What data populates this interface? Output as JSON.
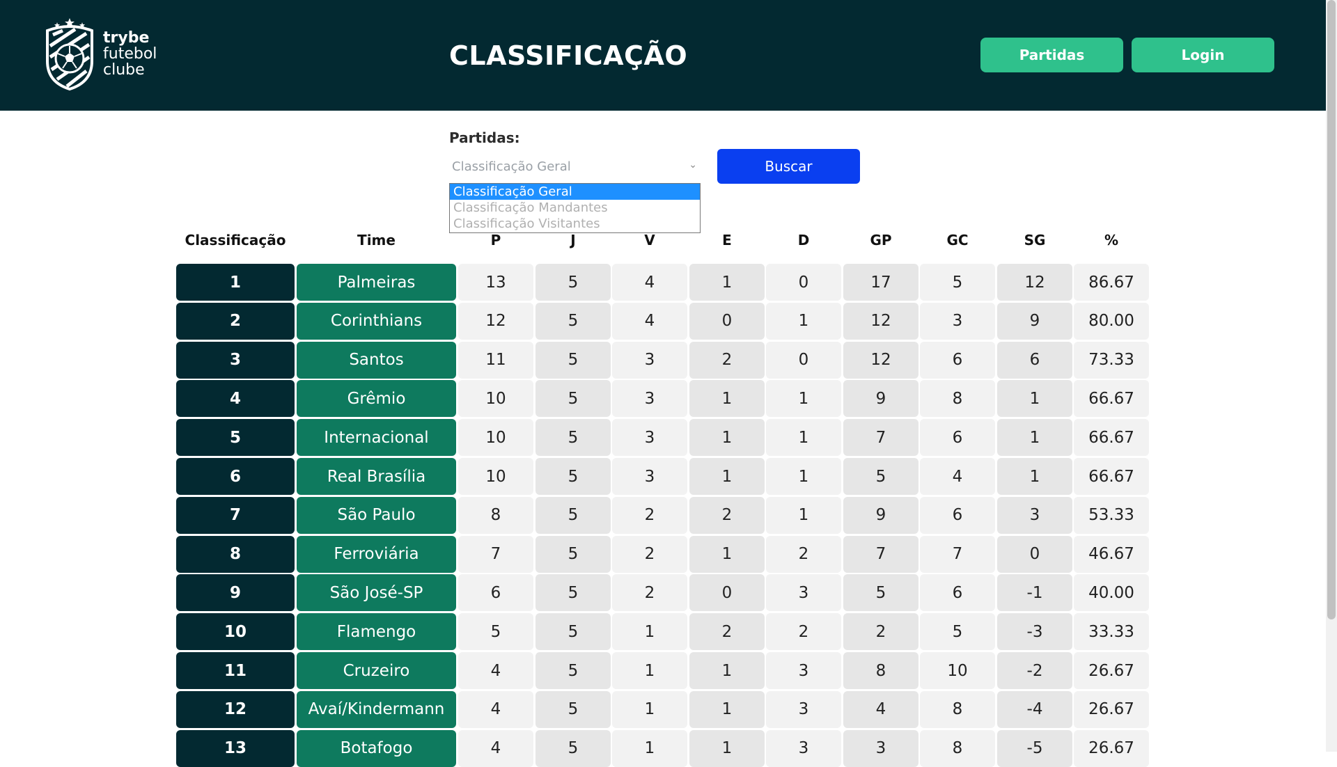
{
  "brand": {
    "line1": "trybe",
    "line2": "futebol",
    "line3": "clube"
  },
  "page_title": "CLASSIFICAÇÃO",
  "nav": {
    "partidas": "Partidas",
    "login": "Login"
  },
  "filter": {
    "label": "Partidas:",
    "selected": "Classificação Geral",
    "options": [
      "Classificação Geral",
      "Classificação Mandantes",
      "Classificação Visitantes"
    ],
    "button": "Buscar"
  },
  "table": {
    "headers": [
      "Classificação",
      "Time",
      "P",
      "J",
      "V",
      "E",
      "D",
      "GP",
      "GC",
      "SG",
      "%"
    ],
    "rows": [
      [
        "1",
        "Palmeiras",
        "13",
        "5",
        "4",
        "1",
        "0",
        "17",
        "5",
        "12",
        "86.67"
      ],
      [
        "2",
        "Corinthians",
        "12",
        "5",
        "4",
        "0",
        "1",
        "12",
        "3",
        "9",
        "80.00"
      ],
      [
        "3",
        "Santos",
        "11",
        "5",
        "3",
        "2",
        "0",
        "12",
        "6",
        "6",
        "73.33"
      ],
      [
        "4",
        "Grêmio",
        "10",
        "5",
        "3",
        "1",
        "1",
        "9",
        "8",
        "1",
        "66.67"
      ],
      [
        "5",
        "Internacional",
        "10",
        "5",
        "3",
        "1",
        "1",
        "7",
        "6",
        "1",
        "66.67"
      ],
      [
        "6",
        "Real Brasília",
        "10",
        "5",
        "3",
        "1",
        "1",
        "5",
        "4",
        "1",
        "66.67"
      ],
      [
        "7",
        "São Paulo",
        "8",
        "5",
        "2",
        "2",
        "1",
        "9",
        "6",
        "3",
        "53.33"
      ],
      [
        "8",
        "Ferroviária",
        "7",
        "5",
        "2",
        "1",
        "2",
        "7",
        "7",
        "0",
        "46.67"
      ],
      [
        "9",
        "São José-SP",
        "6",
        "5",
        "2",
        "0",
        "3",
        "5",
        "6",
        "-1",
        "40.00"
      ],
      [
        "10",
        "Flamengo",
        "5",
        "5",
        "1",
        "2",
        "2",
        "2",
        "5",
        "-3",
        "33.33"
      ],
      [
        "11",
        "Cruzeiro",
        "4",
        "5",
        "1",
        "1",
        "3",
        "8",
        "10",
        "-2",
        "26.67"
      ],
      [
        "12",
        "Avaí/Kindermann",
        "4",
        "5",
        "1",
        "1",
        "3",
        "4",
        "8",
        "-4",
        "26.67"
      ],
      [
        "13",
        "Botafogo",
        "4",
        "5",
        "1",
        "1",
        "3",
        "3",
        "8",
        "-5",
        "26.67"
      ]
    ]
  },
  "colors": {
    "header_bg": "#032931",
    "nav_button": "#2fc18c",
    "search_button": "#0a3ff0",
    "team_cell": "#0e7a5e",
    "position_cell": "#032931"
  }
}
